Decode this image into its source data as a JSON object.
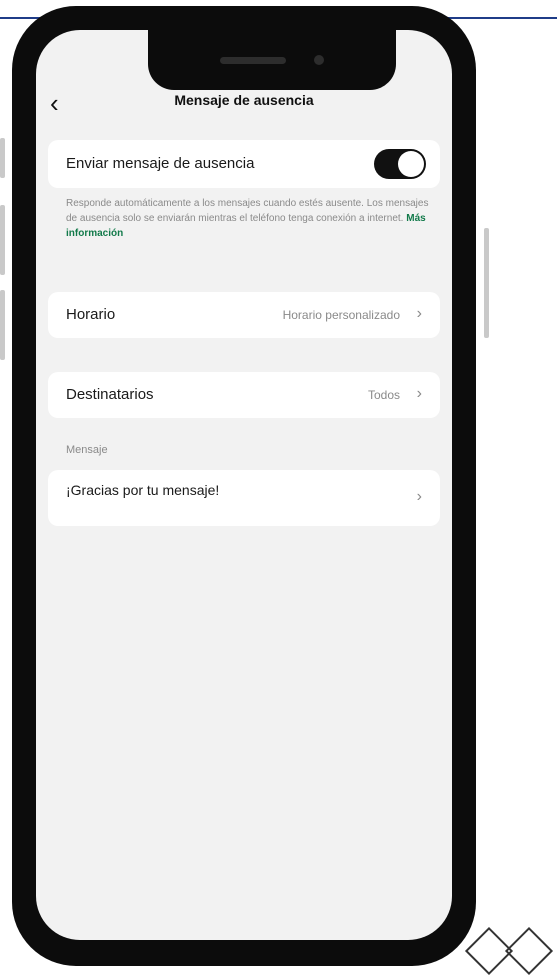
{
  "nav": {
    "back_icon": "chevron-left-icon",
    "title": "Mensaje de ausencia"
  },
  "toggle_row": {
    "label": "Enviar mensaje de ausencia",
    "enabled": true
  },
  "help": {
    "text": "Responde automáticamente a los mensajes cuando estés ausente. Los mensajes de ausencia solo se enviarán mientras el teléfono tenga conexión a internet.",
    "link": "Más información"
  },
  "schedule": {
    "label": "Horario",
    "value": "Horario personalizado",
    "chevron": "›"
  },
  "recipients": {
    "label": "Destinatarios",
    "value": "Todos",
    "chevron": "›"
  },
  "message_section": {
    "label": "Mensaje",
    "text": "¡Gracias por tu mensaje!",
    "chevron": "›"
  },
  "colors": {
    "background": "#f2f2f2",
    "card": "#ffffff",
    "link": "#127a4a",
    "toggle_on": "#111111"
  }
}
